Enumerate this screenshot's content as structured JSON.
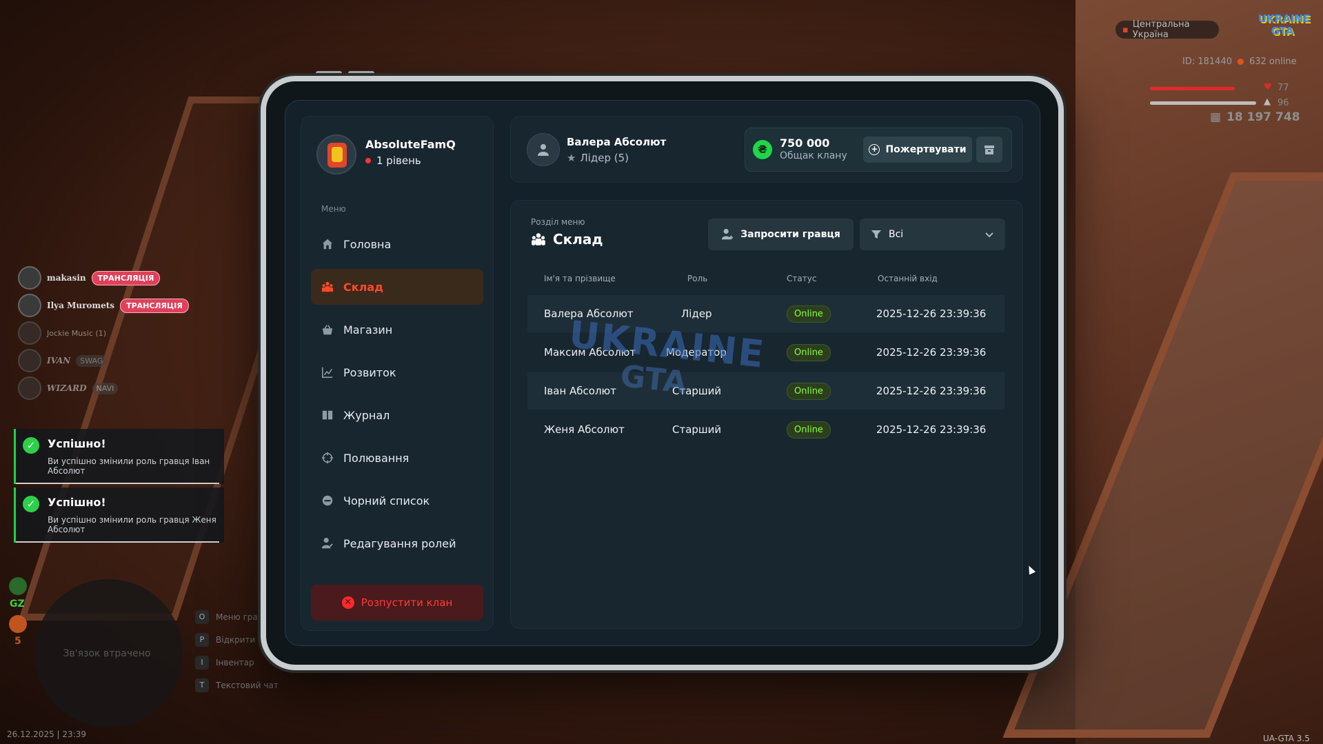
{
  "hud": {
    "region": "Центральна Україна",
    "logo": "UKRAINE GTA",
    "player_id": "ID: 181440",
    "online": "632 online",
    "health": "77",
    "armor": "96",
    "health_fraction": 0.77,
    "armor_fraction": 0.96,
    "money": "18 197 748"
  },
  "voice": [
    {
      "name": "makasin",
      "tag": "ТРАНСЛЯЦІЯ"
    },
    {
      "name": "Ilya Muromets",
      "tag": "ТРАНСЛЯЦІЯ"
    },
    {
      "name": "Jockie Music (1)",
      "tag": ""
    },
    {
      "name": "IVAN",
      "tag": "SWAG"
    },
    {
      "name": "WIZARD",
      "tag": "NAVI"
    }
  ],
  "notifications": [
    {
      "title": "Успішно!",
      "text": "Ви успішно змінили роль гравця Іван Абсолют"
    },
    {
      "title": "Успішно!",
      "text": "Ви успішно змінили роль гравця Женя Абсолют"
    }
  ],
  "minimap": {
    "status": "Зв'язок втрачено",
    "gz_label": "GZ",
    "count": "5"
  },
  "hints": [
    {
      "key": "O",
      "label": "Меню гра"
    },
    {
      "key": "P",
      "label": "Відкрити"
    },
    {
      "key": "I",
      "label": "Інвентар"
    },
    {
      "key": "T",
      "label": "Текстовий чат"
    }
  ],
  "datetime": "26.12.2025 | 23:39",
  "version": "UA-GTA 3.5",
  "clan": {
    "name": "AbsoluteFamQ",
    "level": "1 рівень"
  },
  "menu": {
    "title": "Меню",
    "items": [
      {
        "label": "Головна",
        "icon": "home-icon",
        "active": false
      },
      {
        "label": "Склад",
        "icon": "members-icon",
        "active": true
      },
      {
        "label": "Магазин",
        "icon": "shop-icon",
        "active": false
      },
      {
        "label": "Розвиток",
        "icon": "chart-icon",
        "active": false
      },
      {
        "label": "Журнал",
        "icon": "book-icon",
        "active": false
      },
      {
        "label": "Полювання",
        "icon": "crosshair-icon",
        "active": false
      },
      {
        "label": "Чорний список",
        "icon": "block-icon",
        "active": false
      },
      {
        "label": "Редагування ролей",
        "icon": "user-edit-icon",
        "active": false
      }
    ],
    "disband": "Розпустити клан"
  },
  "user": {
    "name": "Валера Абсолют",
    "role": "Лідер (5)"
  },
  "bank": {
    "amount": "750 000",
    "label": "Общак клану",
    "donate": "Пожертвувати"
  },
  "section": {
    "subtitle": "Розділ меню",
    "title": "Склад",
    "invite": "Запросити гравця",
    "filter_value": "Всі"
  },
  "table": {
    "headers": [
      "Ім'я та прізвище",
      "Роль",
      "Статус",
      "Останній вхід"
    ],
    "rows": [
      {
        "name": "Валера Абсолют",
        "role": "Лідер",
        "status": "Online",
        "last": "2025-12-26 23:39:36"
      },
      {
        "name": "Максим Абсолют",
        "role": "Модератор",
        "status": "Online",
        "last": "2025-12-26 23:39:36"
      },
      {
        "name": "Іван Абсолют",
        "role": "Старший",
        "status": "Online",
        "last": "2025-12-26 23:39:36"
      },
      {
        "name": "Женя Абсолют",
        "role": "Старший",
        "status": "Online",
        "last": "2025-12-26 23:39:36"
      }
    ]
  },
  "watermark": {
    "line1": "UKRAINE",
    "line2": "GTA"
  },
  "colors": {
    "accent": "#ff4a2a",
    "online": "#8fff3a",
    "bank": "#1fd64a",
    "danger": "#ff2a2a"
  }
}
